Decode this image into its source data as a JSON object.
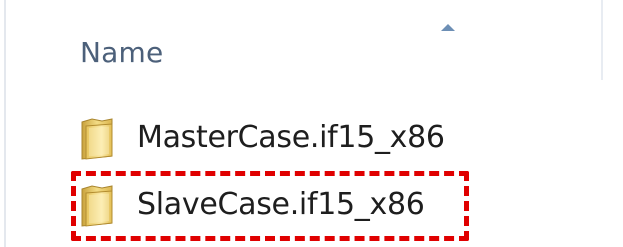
{
  "column_header": {
    "name_label": "Name",
    "sort_direction": "ascending"
  },
  "files": [
    {
      "name": "MasterCase.if15_x86",
      "type": "folder",
      "icon": "folder-icon"
    },
    {
      "name": "SlaveCase.if15_x86",
      "type": "folder",
      "icon": "folder-icon",
      "highlighted": true
    }
  ],
  "colors": {
    "header_text": "#4c607a",
    "file_text": "#1e1e1e",
    "highlight_border": "#e00000",
    "folder_yellow": "#e8c85a"
  }
}
